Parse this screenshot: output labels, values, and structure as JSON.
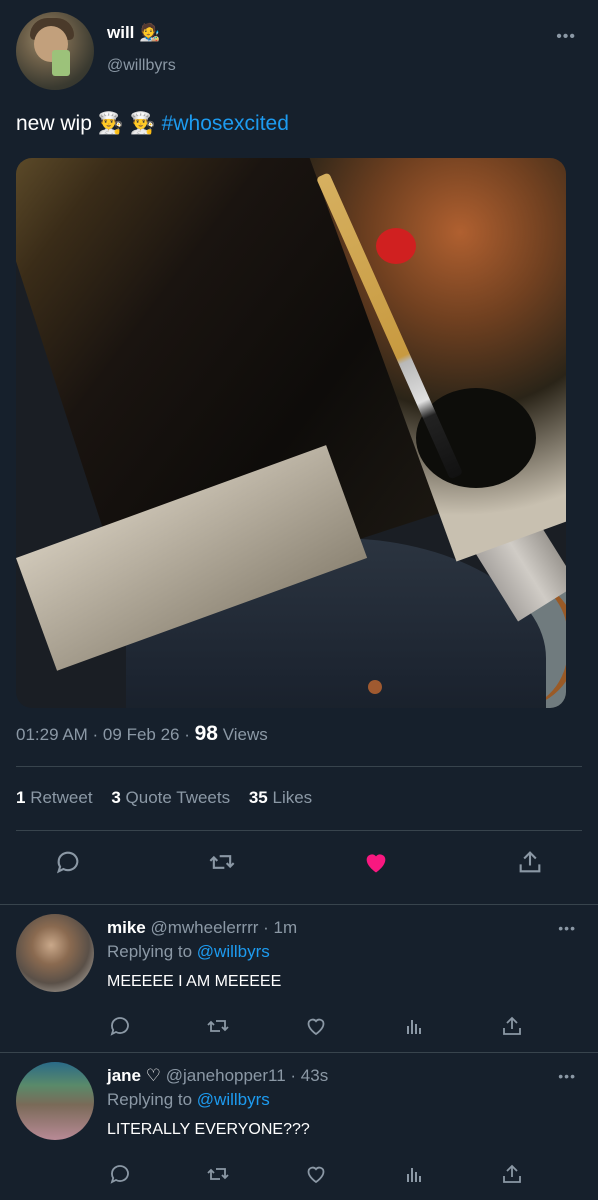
{
  "tweet": {
    "author_name": "will 🧑‍🎨",
    "author_handle": "@willbyrs",
    "text": "new wip 👨‍🍳 👨‍🍳 ",
    "hashtag": "#whosexcited",
    "time": "01:29 AM · 09 Feb 26 · ",
    "views_count": "98",
    "views_label": "Views",
    "more_glyph": "•••"
  },
  "stats": {
    "retweets_count": "1",
    "retweets_label": "Retweet",
    "quotes_count": "3",
    "quotes_label": "Quote Tweets",
    "likes_count": "35",
    "likes_label": "Likes"
  },
  "replies": [
    {
      "name": "mike",
      "handle": "@mwheelerrrr · 1m",
      "replying_prefix": "Replying to ",
      "replying_to": "@willbyrs",
      "text": "MEEEEE I AM MEEEEE"
    },
    {
      "name": "jane ♡",
      "handle": "@janehopper11 · 43s",
      "replying_prefix": "Replying to ",
      "replying_to": "@willbyrs",
      "text": "LITERALLY EVERYONE???"
    }
  ],
  "colors": {
    "background": "#16202c",
    "accent": "#1d9bf0",
    "muted": "#8b98a5",
    "like": "#f91880"
  },
  "icons": [
    "reply-icon",
    "retweet-icon",
    "like-icon",
    "share-icon",
    "analytics-icon",
    "more-icon"
  ]
}
